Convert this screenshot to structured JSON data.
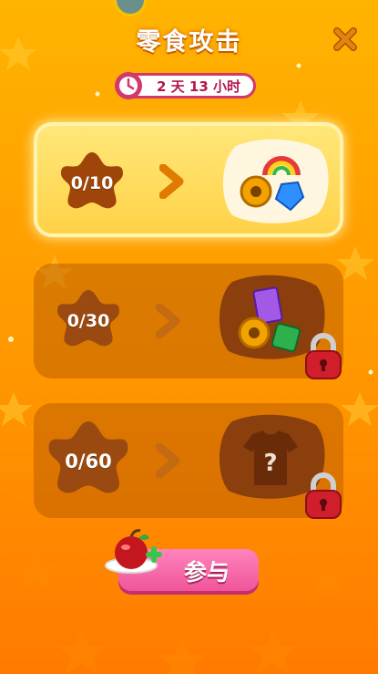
{
  "header": {
    "title": "零食攻击",
    "timer": "2 天 13 小时"
  },
  "tiers": [
    {
      "progress": "0/10",
      "current": 0,
      "target": 10,
      "locked": false,
      "reward": "rainbow-coin-gem"
    },
    {
      "progress": "0/30",
      "current": 0,
      "target": 30,
      "locked": true,
      "reward": "ticket-coin-booster"
    },
    {
      "progress": "0/60",
      "current": 0,
      "target": 60,
      "locked": true,
      "reward": "mystery-shirt"
    }
  ],
  "join_button": {
    "label": "参与"
  },
  "colors": {
    "accent_pink": "#f0559a",
    "timer_border": "#d2386d",
    "star_brown": "#a0450a",
    "lock_red": "#d01e2a"
  }
}
